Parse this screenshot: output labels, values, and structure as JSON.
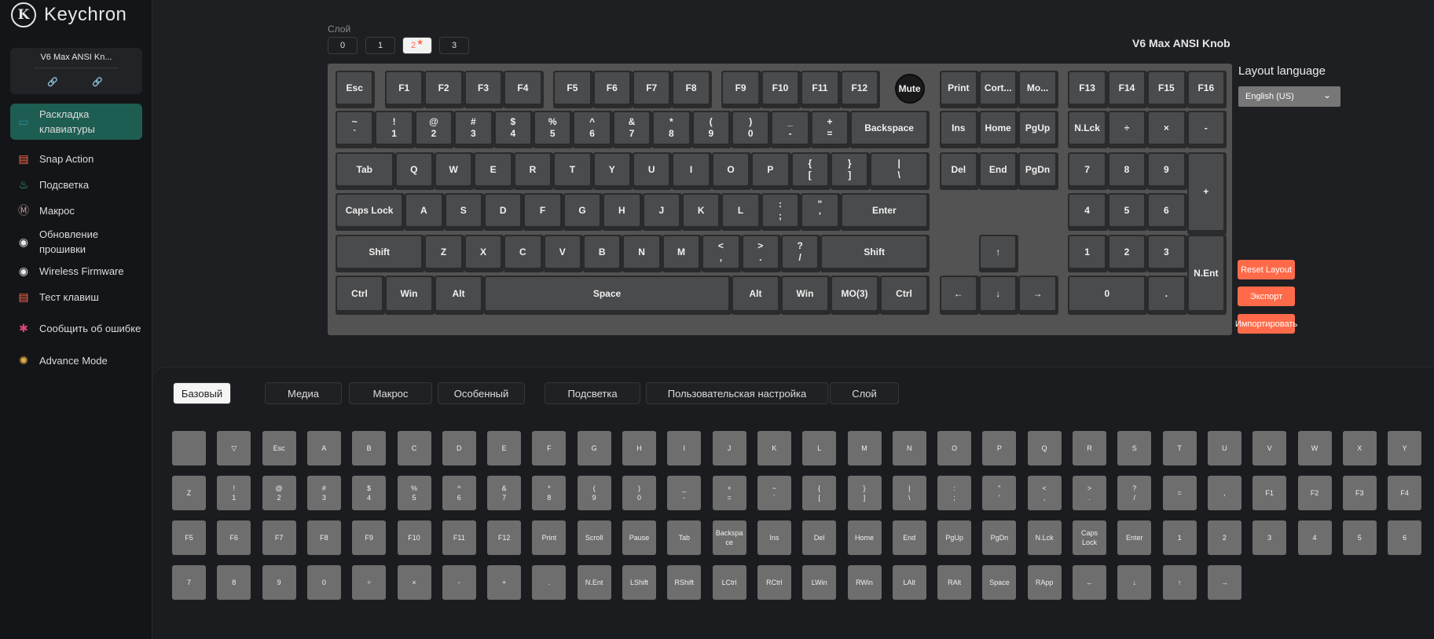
{
  "brand": {
    "name": "Keychron",
    "logo_letter": "K"
  },
  "device": {
    "name": "V6 Max ANSI Kn...",
    "icons": [
      "link-icon",
      "unlink-icon"
    ]
  },
  "nav": [
    {
      "label": "Раскладка клавиатуры",
      "icon": "keyboard-icon",
      "color": "#2a8c9a",
      "active": true
    },
    {
      "label": "Snap Action",
      "icon": "snap-icon",
      "color": "#ff6b4a"
    },
    {
      "label": "Подсветка",
      "icon": "bulb-icon",
      "color": "#2ec27e"
    },
    {
      "label": "Макрос",
      "icon": "macro-icon",
      "color": "#c0a0a0"
    },
    {
      "label": "Обновление прошивки",
      "icon": "update-icon",
      "color": "#e6e6e6"
    },
    {
      "label": "Wireless Firmware",
      "icon": "wireless-update-icon",
      "color": "#e6e6e6"
    },
    {
      "label": "Тест клавиш",
      "icon": "test-icon",
      "color": "#ff6b4a"
    },
    {
      "label": "Сообщить об ошибке",
      "icon": "bug-icon",
      "color": "#e0457b"
    },
    {
      "label": "Advance Mode",
      "icon": "gear-icon",
      "color": "#e6b34a"
    }
  ],
  "layers": {
    "title": "Слой",
    "items": [
      "0",
      "1",
      "2",
      "3"
    ],
    "active": 2
  },
  "keyboard_name": "V6 Max ANSI Knob",
  "layout_language": {
    "label": "Layout language",
    "value": "English (US)"
  },
  "actions": {
    "reset": "Reset Layout",
    "export": "Экспорт",
    "import": "Импортировать"
  },
  "keys": {
    "row0": [
      [
        "Esc"
      ],
      [
        "F1"
      ],
      [
        "F2"
      ],
      [
        "F3"
      ],
      [
        "F4"
      ],
      [
        "F5"
      ],
      [
        "F6"
      ],
      [
        "F7"
      ],
      [
        "F8"
      ],
      [
        "F9"
      ],
      [
        "F10"
      ],
      [
        "F11"
      ],
      [
        "F12"
      ],
      [
        "Print"
      ],
      [
        "Cort..."
      ],
      [
        "Mo..."
      ],
      [
        "F13"
      ],
      [
        "F14"
      ],
      [
        "F15"
      ],
      [
        "F16"
      ]
    ],
    "knob": "Mute",
    "row1": [
      [
        "~",
        "`"
      ],
      [
        "!",
        "1"
      ],
      [
        "@",
        "2"
      ],
      [
        "#",
        "3"
      ],
      [
        "$",
        "4"
      ],
      [
        "%",
        "5"
      ],
      [
        "^",
        "6"
      ],
      [
        "&",
        "7"
      ],
      [
        "*",
        "8"
      ],
      [
        "(",
        "9"
      ],
      [
        ")",
        "0"
      ],
      [
        "_",
        "-"
      ],
      [
        "+",
        "="
      ],
      [
        "Backspace"
      ],
      [
        "Ins"
      ],
      [
        "Home"
      ],
      [
        "PgUp"
      ],
      [
        "N.Lck"
      ],
      [
        "÷"
      ],
      [
        "×"
      ],
      [
        "-"
      ]
    ],
    "row2": [
      [
        "Tab"
      ],
      [
        "Q"
      ],
      [
        "W"
      ],
      [
        "E"
      ],
      [
        "R"
      ],
      [
        "T"
      ],
      [
        "Y"
      ],
      [
        "U"
      ],
      [
        "I"
      ],
      [
        "O"
      ],
      [
        "P"
      ],
      [
        "{",
        "["
      ],
      [
        "}",
        "]"
      ],
      [
        "|",
        "\\"
      ],
      [
        "Del"
      ],
      [
        "End"
      ],
      [
        "PgDn"
      ],
      [
        "7"
      ],
      [
        "8"
      ],
      [
        "9"
      ],
      [
        "+"
      ]
    ],
    "row3": [
      [
        "Caps Lock"
      ],
      [
        "A"
      ],
      [
        "S"
      ],
      [
        "D"
      ],
      [
        "F"
      ],
      [
        "G"
      ],
      [
        "H"
      ],
      [
        "J"
      ],
      [
        "K"
      ],
      [
        "L"
      ],
      [
        ":",
        ";"
      ],
      [
        "\"",
        "'"
      ],
      [
        "Enter"
      ],
      [
        "4"
      ],
      [
        "5"
      ],
      [
        "6"
      ]
    ],
    "row4": [
      [
        "Shift"
      ],
      [
        "Z"
      ],
      [
        "X"
      ],
      [
        "C"
      ],
      [
        "V"
      ],
      [
        "B"
      ],
      [
        "N"
      ],
      [
        "M"
      ],
      [
        "<",
        ","
      ],
      [
        ">",
        "."
      ],
      [
        "?",
        "/"
      ],
      [
        "Shift"
      ],
      [
        "↑"
      ],
      [
        "1"
      ],
      [
        "2"
      ],
      [
        "3"
      ],
      [
        "N.Ent"
      ]
    ],
    "row5": [
      [
        "Ctrl"
      ],
      [
        "Win"
      ],
      [
        "Alt"
      ],
      [
        "Space"
      ],
      [
        "Alt"
      ],
      [
        "Win"
      ],
      [
        "MO(3)"
      ],
      [
        "Ctrl"
      ],
      [
        "←"
      ],
      [
        "↓"
      ],
      [
        "→"
      ],
      [
        "0"
      ],
      [
        "."
      ]
    ]
  },
  "tabs": {
    "items": [
      "Базовый",
      "Медиа",
      "Макрос",
      "Особенный",
      "Подсветка",
      "Пользовательская настройка",
      "Слой"
    ],
    "active": 0
  },
  "palette": [
    [
      [
        ""
      ],
      [
        "▽"
      ],
      [
        "Esc"
      ],
      [
        "A"
      ],
      [
        "B"
      ],
      [
        "C"
      ],
      [
        "D"
      ],
      [
        "E"
      ],
      [
        "F"
      ],
      [
        "G"
      ],
      [
        "H"
      ],
      [
        "I"
      ],
      [
        "J"
      ],
      [
        "K"
      ],
      [
        "L"
      ],
      [
        "M"
      ],
      [
        "N"
      ],
      [
        "O"
      ],
      [
        "P"
      ],
      [
        "Q"
      ],
      [
        "R"
      ],
      [
        "S"
      ],
      [
        "T"
      ],
      [
        "U"
      ],
      [
        "V"
      ],
      [
        "W"
      ],
      [
        "X"
      ],
      [
        "Y"
      ]
    ],
    [
      [
        "Z"
      ],
      [
        "!",
        "1"
      ],
      [
        "@",
        "2"
      ],
      [
        "#",
        "3"
      ],
      [
        "$",
        "4"
      ],
      [
        "%",
        "5"
      ],
      [
        "^",
        "6"
      ],
      [
        "&",
        "7"
      ],
      [
        "*",
        "8"
      ],
      [
        "(",
        "9"
      ],
      [
        ")",
        "0"
      ],
      [
        "_",
        "-"
      ],
      [
        "+",
        "="
      ],
      [
        "~",
        "`"
      ],
      [
        "{",
        "["
      ],
      [
        "}",
        "]"
      ],
      [
        "|",
        "\\"
      ],
      [
        ":",
        ";"
      ],
      [
        "\"",
        "'"
      ],
      [
        "<",
        ","
      ],
      [
        ">",
        "."
      ],
      [
        "?",
        "/"
      ],
      [
        "="
      ],
      [
        ","
      ],
      [
        "F1"
      ],
      [
        "F2"
      ],
      [
        "F3"
      ],
      [
        "F4"
      ]
    ],
    [
      [
        "F5"
      ],
      [
        "F6"
      ],
      [
        "F7"
      ],
      [
        "F8"
      ],
      [
        "F9"
      ],
      [
        "F10"
      ],
      [
        "F11"
      ],
      [
        "F12"
      ],
      [
        "Print"
      ],
      [
        "Scroll"
      ],
      [
        "Pause"
      ],
      [
        "Tab"
      ],
      [
        "Backspa",
        "ce"
      ],
      [
        "Ins"
      ],
      [
        "Del"
      ],
      [
        "Home"
      ],
      [
        "End"
      ],
      [
        "PgUp"
      ],
      [
        "PgDn"
      ],
      [
        "N.Lck"
      ],
      [
        "Caps",
        "Lock"
      ],
      [
        "Enter"
      ],
      [
        "1"
      ],
      [
        "2"
      ],
      [
        "3"
      ],
      [
        "4"
      ],
      [
        "5"
      ],
      [
        "6"
      ]
    ],
    [
      [
        "7"
      ],
      [
        "8"
      ],
      [
        "9"
      ],
      [
        "0"
      ],
      [
        "÷"
      ],
      [
        "×"
      ],
      [
        "-"
      ],
      [
        "+"
      ],
      [
        "."
      ],
      [
        "N.Ent"
      ],
      [
        "LShift"
      ],
      [
        "RShift"
      ],
      [
        "LCtrl"
      ],
      [
        "RCtrl"
      ],
      [
        "LWin"
      ],
      [
        "RWin"
      ],
      [
        "LAlt"
      ],
      [
        "RAlt"
      ],
      [
        "Space"
      ],
      [
        "RApp"
      ],
      [
        "←"
      ],
      [
        "↓"
      ],
      [
        "↑"
      ],
      [
        "→"
      ]
    ]
  ],
  "colors": {
    "accent": "#ff6b4a",
    "active_nav": "#1e5d51",
    "key_cap": "#4a4b4d",
    "palette_key": "#6e6e6e"
  }
}
